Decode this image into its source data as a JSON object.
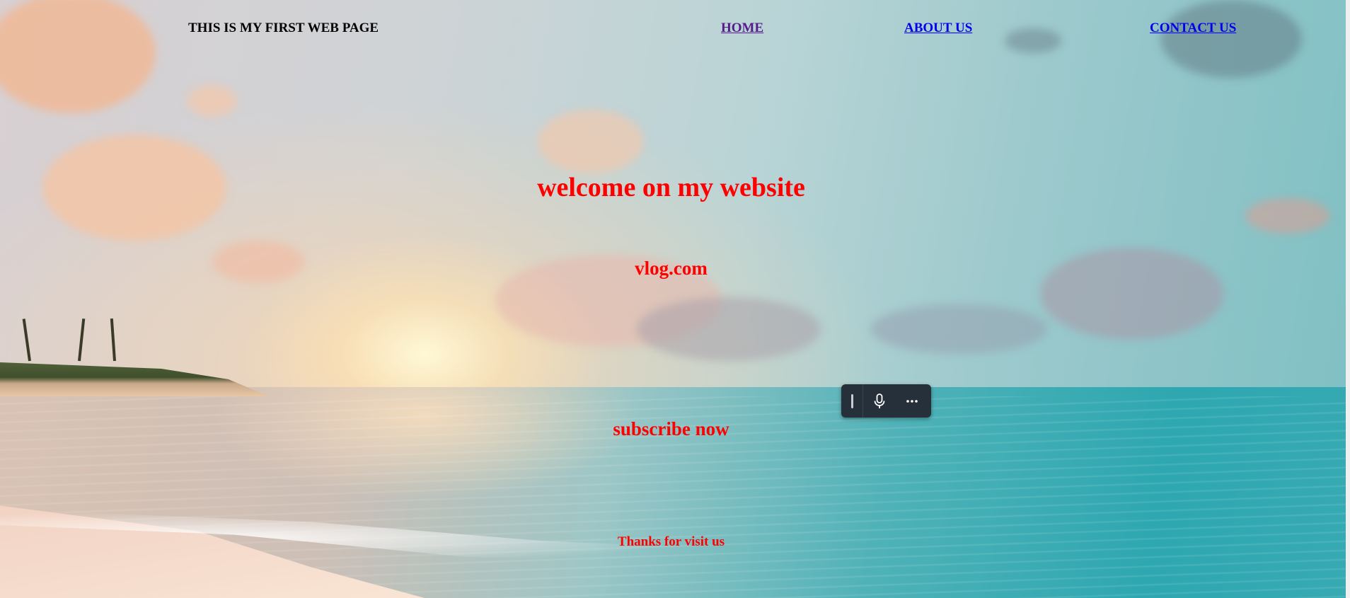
{
  "header": {
    "title": "THIS IS MY FIRST WEB PAGE"
  },
  "nav": {
    "home": "HOME",
    "about": "ABOUT US",
    "contact": "CONTACT US"
  },
  "main": {
    "welcome": "welcome on my website",
    "site": "vlog.com",
    "subscribe": "subscribe now",
    "thanks": "Thanks for visit us"
  },
  "voice_toolbar": {
    "icons": [
      "drag-handle-icon",
      "microphone-icon",
      "more-options-icon"
    ]
  },
  "colors": {
    "headline_red": "#ff0000",
    "link_blue": "#0000ee",
    "link_visited": "#551a8b",
    "toolbar_bg": "#26303a"
  }
}
